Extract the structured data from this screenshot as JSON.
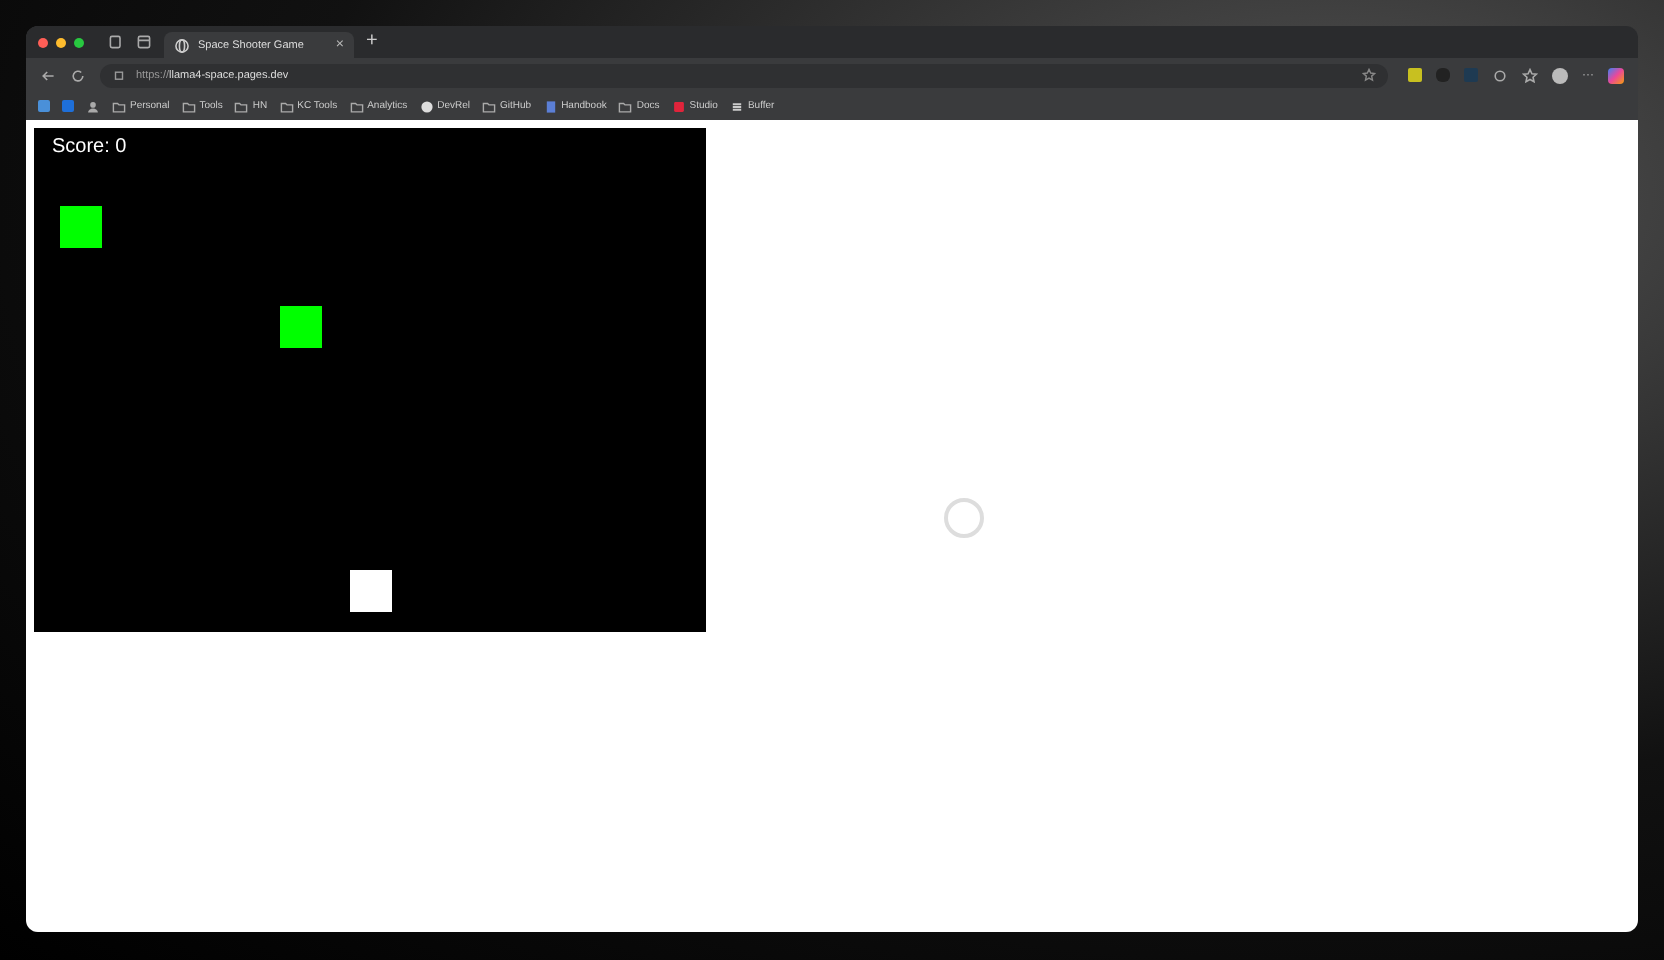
{
  "tab": {
    "title": "Space Shooter Game",
    "close": "×"
  },
  "new_tab": "+",
  "address": {
    "scheme": "https://",
    "host": "llama4-space.pages.dev"
  },
  "bookmarks": [
    {
      "label": "Personal",
      "kind": "folder"
    },
    {
      "label": "Tools",
      "kind": "folder"
    },
    {
      "label": "HN",
      "kind": "folder"
    },
    {
      "label": "KC Tools",
      "kind": "folder"
    },
    {
      "label": "Analytics",
      "kind": "folder"
    },
    {
      "label": "DevRel",
      "kind": "github"
    },
    {
      "label": "GitHub",
      "kind": "folder"
    },
    {
      "label": "Handbook",
      "kind": "doc"
    },
    {
      "label": "Docs",
      "kind": "folder"
    },
    {
      "label": "Studio",
      "kind": "app"
    },
    {
      "label": "Buffer",
      "kind": "stack"
    }
  ],
  "more": "···",
  "game": {
    "score": "Score: 0"
  }
}
